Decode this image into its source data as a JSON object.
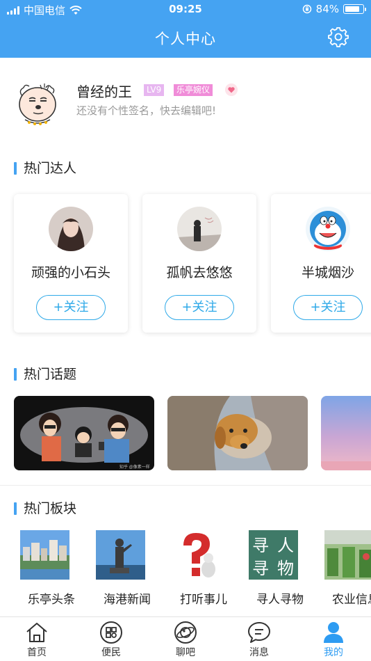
{
  "status_bar": {
    "carrier": "中国电信",
    "time": "09:25",
    "battery": "84%",
    "battery_level": 0.84
  },
  "nav": {
    "title": "个人中心",
    "settings_icon": "gear-icon"
  },
  "profile": {
    "name": "曾经的王",
    "level": "LV9",
    "title": "乐亭婉仪",
    "signature": "还没有个性签名，快去编辑吧!"
  },
  "sections": {
    "experts": "热门达人",
    "topics": "热门话题",
    "boards": "热门板块"
  },
  "experts": [
    {
      "name": "顽强的小石头",
      "follow": "+关注"
    },
    {
      "name": "孤帆去悠悠",
      "follow": "+关注"
    },
    {
      "name": "半城烟沙",
      "follow": "+关注"
    }
  ],
  "topics": [
    {
      "caption": "知乎 @像素一样"
    },
    {
      "caption": ""
    },
    {
      "caption": ""
    }
  ],
  "boards": [
    {
      "label": "乐亭头条"
    },
    {
      "label": "海港新闻"
    },
    {
      "label": "打听事儿"
    },
    {
      "label": "寻人寻物",
      "tile_text": [
        "寻",
        "人",
        "寻",
        "物"
      ]
    },
    {
      "label": "农业信息"
    }
  ],
  "tabs": [
    {
      "label": "首页",
      "icon": "home-icon"
    },
    {
      "label": "便民",
      "icon": "grid-icon"
    },
    {
      "label": "聊吧",
      "icon": "planet-icon"
    },
    {
      "label": "消息",
      "icon": "chat-bubble-icon"
    },
    {
      "label": "我的",
      "icon": "user-icon",
      "active": true
    }
  ],
  "colors": {
    "primary": "#45a3f2",
    "follow": "#2ea9e8",
    "active_tab": "#2e9cf2"
  }
}
